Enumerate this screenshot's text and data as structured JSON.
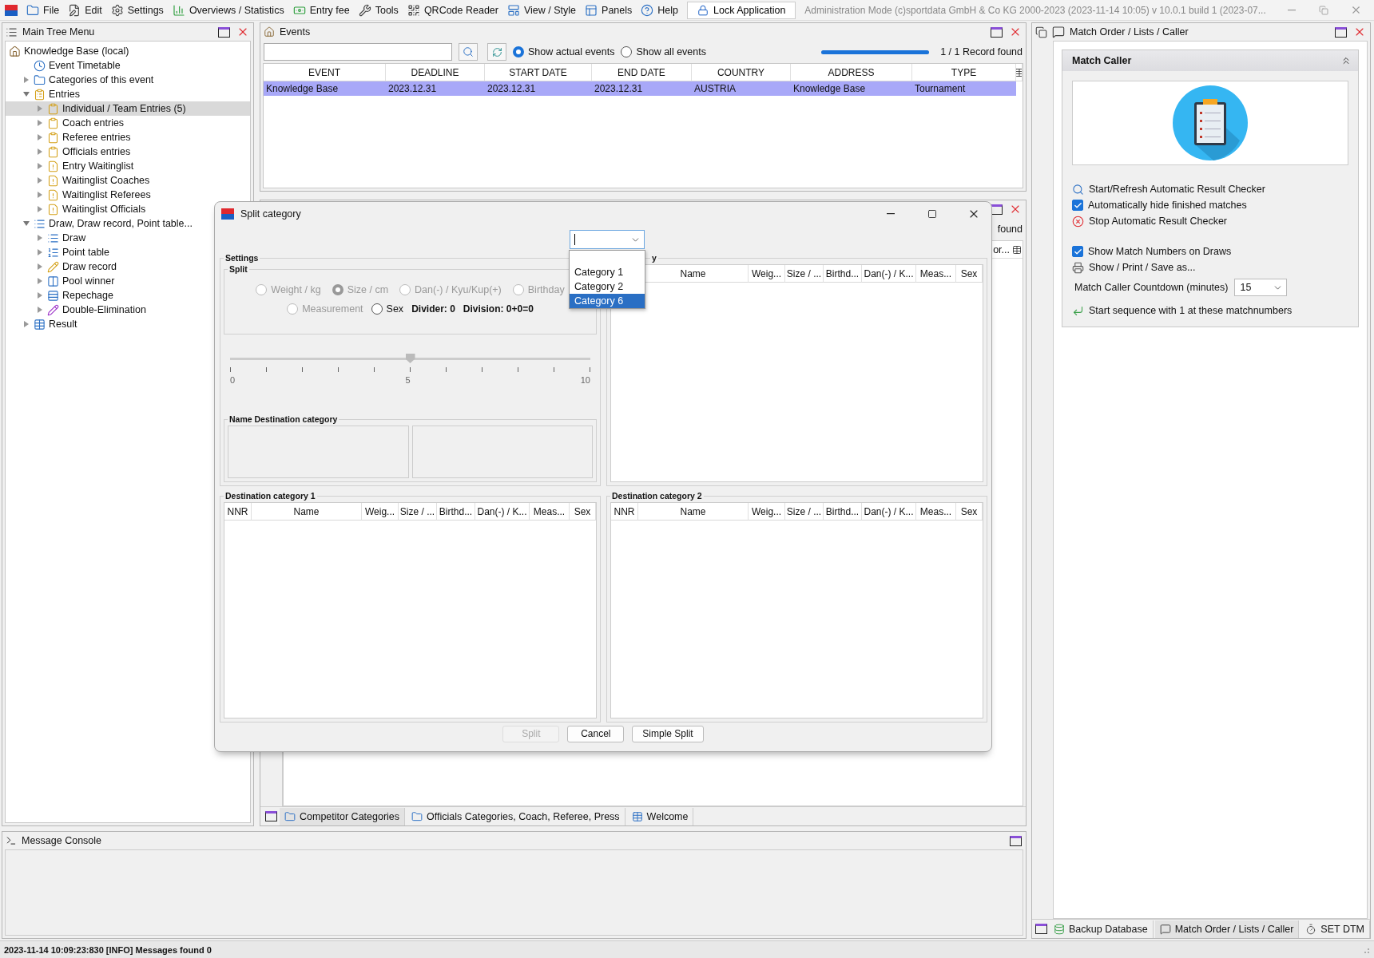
{
  "menu_bar": {
    "items": [
      {
        "label": "File"
      },
      {
        "label": "Edit"
      },
      {
        "label": "Settings"
      },
      {
        "label": "Overviews / Statistics"
      },
      {
        "label": "Entry fee"
      },
      {
        "label": "Tools"
      },
      {
        "label": "QRCode Reader"
      },
      {
        "label": "View / Style"
      },
      {
        "label": "Panels"
      },
      {
        "label": "Help"
      }
    ],
    "lock_button": "Lock Application",
    "title": "Administration Mode (c)sportdata GmbH & Co KG 2000-2023 (2023-11-14 10:05)  v 10.0.1 build 1 (2023-07..."
  },
  "tree_panel": {
    "title": "Main Tree Menu",
    "root": "Knowledge Base (local)",
    "items": [
      {
        "label": "Event Timetable",
        "selected": false
      },
      {
        "label": "Categories of this event",
        "selected": false,
        "expanded": false
      },
      {
        "label": "Entries",
        "selected": false,
        "expanded": true,
        "children": [
          {
            "label": "Individual / Team Entries (5)",
            "selected": true,
            "expanded": false
          },
          {
            "label": "Coach entries",
            "selected": false,
            "expanded": false
          },
          {
            "label": "Referee entries",
            "selected": false,
            "expanded": false
          },
          {
            "label": "Officials entries",
            "selected": false,
            "expanded": false
          },
          {
            "label": "Entry Waitinglist",
            "selected": false,
            "expanded": false
          },
          {
            "label": "Waitinglist Coaches",
            "selected": false,
            "expanded": false
          },
          {
            "label": "Waitinglist Referees",
            "selected": false,
            "expanded": false
          },
          {
            "label": "Waitinglist Officials",
            "selected": false,
            "expanded": false
          }
        ]
      },
      {
        "label": "Draw, Draw record, Point table...",
        "selected": false,
        "expanded": true,
        "children": [
          {
            "label": "Draw",
            "selected": false,
            "expanded": false
          },
          {
            "label": "Point table",
            "selected": false,
            "expanded": false
          },
          {
            "label": "Draw record",
            "selected": false,
            "expanded": false
          },
          {
            "label": "Pool winner",
            "selected": false,
            "expanded": false
          },
          {
            "label": "Repechage",
            "selected": false,
            "expanded": false
          },
          {
            "label": "Double-Elimination",
            "selected": false,
            "expanded": false
          }
        ]
      },
      {
        "label": "Result",
        "selected": false,
        "expanded": false
      }
    ]
  },
  "events_panel": {
    "title": "Events",
    "filters": [
      {
        "label": "Show actual events",
        "selected": true
      },
      {
        "label": "Show all events",
        "selected": false
      }
    ],
    "progress": {
      "level": 1
    },
    "record_count": "1 / 1 Record found",
    "table": {
      "columns": [
        "EVENT",
        "DEADLINE",
        "START DATE",
        "END DATE",
        "COUNTRY",
        "ADDRESS",
        "TYPE"
      ],
      "rows": [
        {
          "selected": true,
          "cells": [
            "Knowledge Base",
            "2023.12.31",
            "2023.12.31",
            "2023.12.31",
            "AUSTRIA",
            "Knowledge Base",
            "Tournament"
          ]
        }
      ]
    }
  },
  "categories_panel": {
    "found_text": "found",
    "column_heading": "or...",
    "tabs": [
      {
        "label": "Competitor Categories",
        "selected": true
      },
      {
        "label": "Officials Categories, Coach, Referee, Press",
        "selected": false
      },
      {
        "label": "Welcome",
        "selected": false
      }
    ]
  },
  "message_console": {
    "title": "Message Console"
  },
  "status_bar": "2023-11-14 10:09:23:830 [INFO] Messages found 0",
  "right_panel": {
    "title": "Match Order / Lists / Caller",
    "section_title": "Match Caller",
    "checker_items": [
      {
        "kind": "action",
        "label": "Start/Refresh Automatic Result Checker"
      },
      {
        "kind": "checkbox",
        "label": "Automatically hide finished matches",
        "checked": true
      },
      {
        "kind": "action",
        "label": "Stop Automatic Result Checker"
      }
    ],
    "draw_items": [
      {
        "kind": "checkbox",
        "label": "Show Match Numbers on Draws",
        "checked": true
      },
      {
        "kind": "action",
        "label": "Show / Print / Save as..."
      }
    ],
    "countdown": {
      "label": "Match Caller Countdown (minutes)",
      "value": "15"
    },
    "sequence": "Start sequence with 1 at these matchnumbers",
    "tabs": [
      {
        "label": "Backup Database",
        "selected": false
      },
      {
        "label": "Match Order / Lists / Caller",
        "selected": true
      },
      {
        "label": "SET DTM",
        "selected": false
      }
    ]
  },
  "dialog": {
    "title": "Split category",
    "dropdown_options": [
      {
        "label": "Category 1",
        "selected": false
      },
      {
        "label": "Category 2",
        "selected": false
      },
      {
        "label": "Category 6",
        "selected": true
      }
    ],
    "settings_title": "Settings",
    "split_title": "Split",
    "split_options": [
      {
        "label": "Weight / kg",
        "selected": false,
        "disabled": true
      },
      {
        "label": "Size / cm",
        "selected": true,
        "disabled": true
      },
      {
        "label": "Dan(-) / Kyu/Kup(+)",
        "selected": false,
        "disabled": true
      },
      {
        "label": "Birthday",
        "selected": false,
        "disabled": true
      },
      {
        "label": "Measurement",
        "selected": false,
        "disabled": true
      },
      {
        "label": "Sex",
        "selected": false,
        "disabled": false
      }
    ],
    "divider": "Divider: 0",
    "division": "Division: 0+0=0",
    "slider": {
      "level": 0.5,
      "labels": [
        "0",
        "5",
        "10"
      ]
    },
    "name_title": "Name Destination category",
    "source_title": "y",
    "source_columns": [
      "Name",
      "Weig...",
      "Size / ...",
      "Birthd...",
      "Dan(-) / K...",
      "Meas...",
      "Sex"
    ],
    "destinations": [
      {
        "title": "Destination category 1",
        "columns": [
          "NNR",
          "Name",
          "Weig...",
          "Size / ...",
          "Birthd...",
          "Dan(-) / K...",
          "Meas...",
          "Sex"
        ]
      },
      {
        "title": "Destination category 2",
        "columns": [
          "NNR",
          "Name",
          "Weig...",
          "Size / ...",
          "Birthd...",
          "Dan(-) / K...",
          "Meas...",
          "Sex"
        ]
      }
    ],
    "buttons": [
      {
        "label": "Split",
        "disabled": true
      },
      {
        "label": "Cancel",
        "disabled": false
      },
      {
        "label": "Simple Split",
        "disabled": false
      }
    ]
  }
}
